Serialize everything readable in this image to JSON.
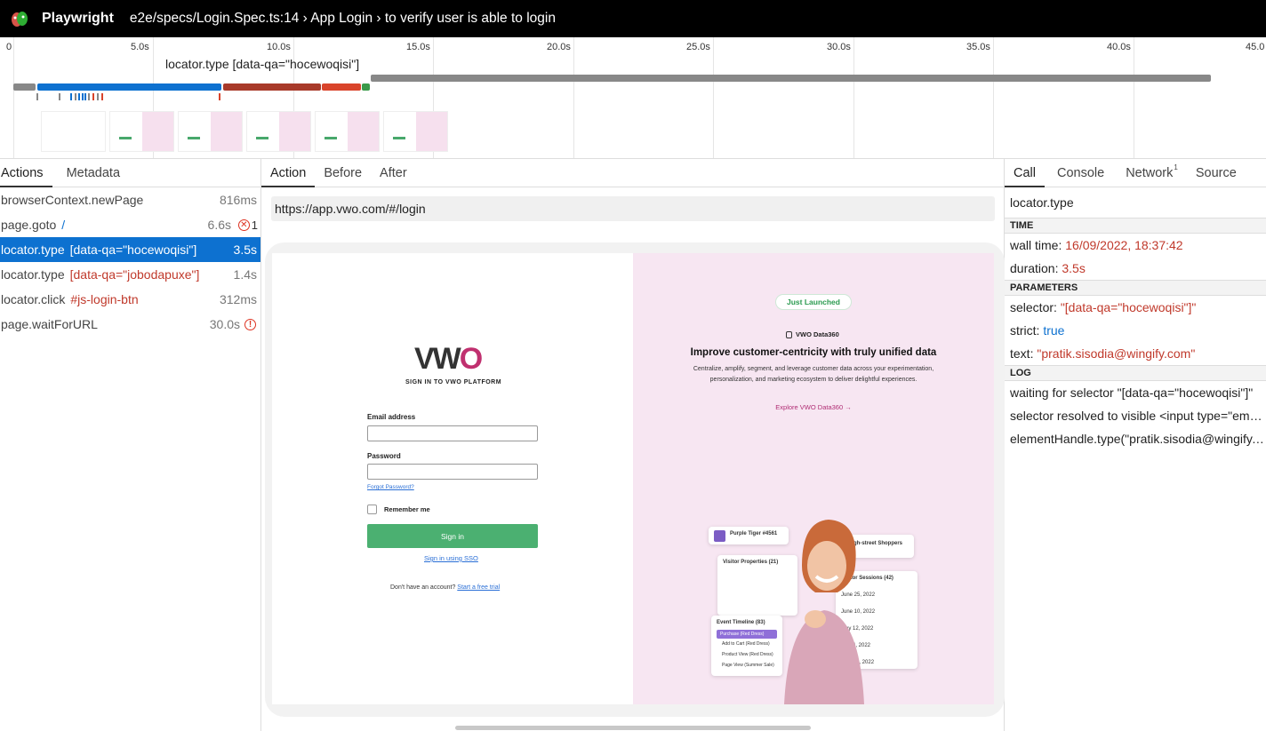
{
  "header": {
    "app_title": "Playwright",
    "test_title": "e2e/specs/Login.Spec.ts:14 › App Login › to verify user is able to login"
  },
  "timeline": {
    "ticks": [
      "0",
      "5.0s",
      "10.0s",
      "15.0s",
      "20.0s",
      "25.0s",
      "30.0s",
      "35.0s",
      "40.0s",
      "45.0"
    ],
    "hover_label": "locator.type [data-qa=\"hocewoqisi\"]",
    "colors": {
      "goto": "#0d71d0",
      "type": "#a83a2a",
      "type2": "#d9442b",
      "click": "#3a9a4a",
      "wait": "#888888"
    }
  },
  "left_panel": {
    "tabs": [
      "Actions",
      "Metadata"
    ],
    "actions": [
      {
        "name": "browserContext.newPage",
        "selector": "",
        "duration": "816ms"
      },
      {
        "name": "page.goto",
        "selector": "/",
        "duration": "6.6s",
        "error_count": "1"
      },
      {
        "name": "locator.type",
        "selector": "[data-qa=\"hocewoqisi\"]",
        "duration": "3.5s",
        "selected": true
      },
      {
        "name": "locator.type",
        "selector": "[data-qa=\"jobodapuxe\"]",
        "duration": "1.4s"
      },
      {
        "name": "locator.click",
        "selector": "#js-login-btn",
        "duration": "312ms"
      },
      {
        "name": "page.waitForURL",
        "selector": "",
        "duration": "30.0s",
        "error": "!"
      }
    ]
  },
  "mid_panel": {
    "tabs": [
      "Action",
      "Before",
      "After"
    ],
    "url": "https://app.vwo.com/#/login",
    "login": {
      "logo_prefix": "VW",
      "logo_suffix": "O",
      "heading": "SIGN IN TO VWO PLATFORM",
      "email_label": "Email address",
      "password_label": "Password",
      "forgot": "Forgot Password?",
      "remember": "Remember me",
      "signin": "Sign in",
      "sso": "Sign in using SSO",
      "no_account": "Don't have an account?",
      "free_trial": "Start a free trial"
    },
    "promo": {
      "badge": "Just Launched",
      "product": "VWO Data360",
      "headline": "Improve customer-centricity with truly unified data",
      "body": "Centralize, amplify, segment, and leverage customer data across your experimentation, personalization, and marketing ecosystem to deliver delightful experiences.",
      "cta": "Explore VWO Data360 →",
      "card_tiger": "Purple Tiger #4561",
      "card_shoppers": "High-street Shoppers",
      "card_visitor": "Visitor Properties (21)",
      "card_sessions": "Visitor Sessions (42)",
      "card_timeline": "Event Timeline (83)",
      "session_dates": [
        "June 25, 2022",
        "June 10, 2022",
        "May 12, 2022",
        "May 6, 2022",
        "April 20, 2022"
      ],
      "timeline_items": [
        "Purchase (Red Dress)",
        "Add to Cart (Red Dress)",
        "Product View (Red Dress)",
        "Page View (Summer Sale)"
      ]
    }
  },
  "right_panel": {
    "tabs": [
      "Call",
      "Console",
      "Network",
      "Source"
    ],
    "network_count": "1",
    "title": "locator.type",
    "sections": {
      "time": "TIME",
      "parameters": "PARAMETERS",
      "log": "LOG"
    },
    "time": {
      "wall_label": "wall time:",
      "wall_value": "16/09/2022, 18:37:42",
      "duration_label": "duration:",
      "duration_value": "3.5s"
    },
    "params": {
      "selector_label": "selector:",
      "selector_value": "\"[data-qa=\"hocewoqisi\"]\"",
      "strict_label": "strict:",
      "strict_value": "true",
      "text_label": "text:",
      "text_value": "\"pratik.sisodia@wingify.com\""
    },
    "log": [
      "waiting for selector \"[data-qa=\"hocewoqisi\"]\"",
      "selector resolved to visible <input type=\"email\" name=\"username\">",
      "elementHandle.type(\"pratik.sisodia@wingify.com\")"
    ]
  }
}
